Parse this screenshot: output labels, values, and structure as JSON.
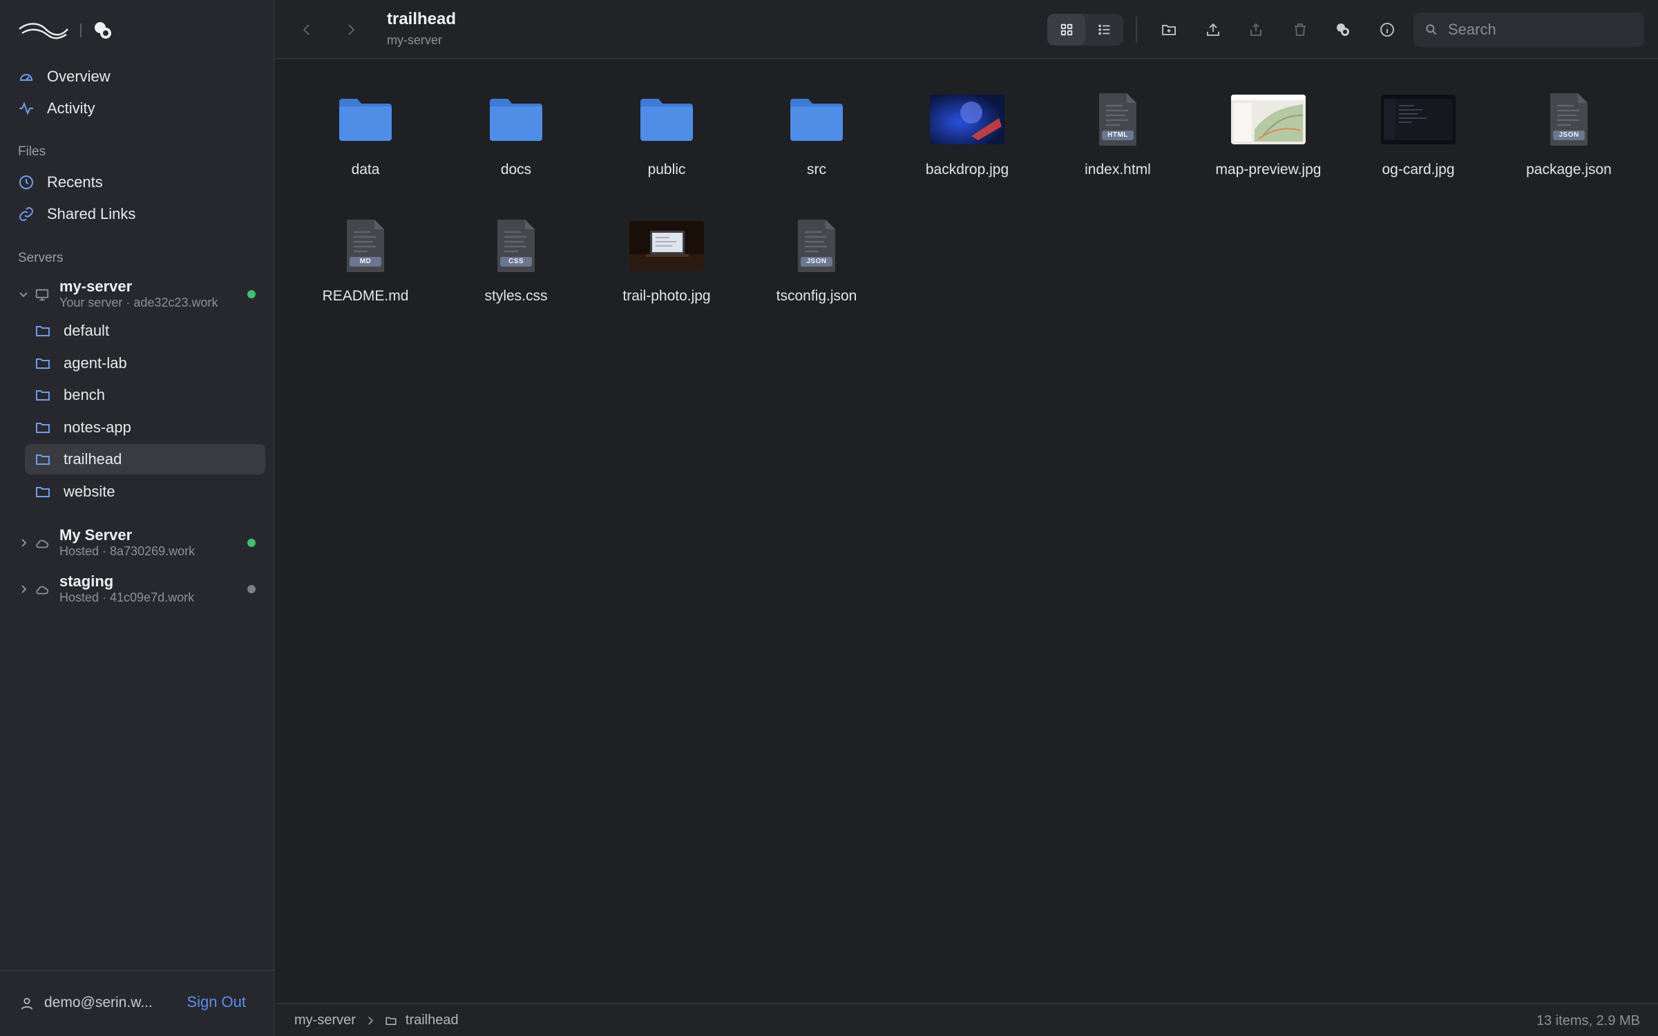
{
  "sidebar": {
    "nav": [
      {
        "label": "Overview",
        "icon": "gauge-icon"
      },
      {
        "label": "Activity",
        "icon": "activity-icon"
      }
    ],
    "files_label": "Files",
    "files": [
      {
        "label": "Recents",
        "icon": "clock-icon"
      },
      {
        "label": "Shared Links",
        "icon": "link-icon"
      }
    ],
    "servers_label": "Servers",
    "servers": [
      {
        "name": "my-server",
        "sub": "Your server · ade32c23.work",
        "status": "online",
        "expanded": true
      },
      {
        "name": "My Server",
        "sub": "Hosted · 8a730269.work",
        "status": "online",
        "expanded": false
      },
      {
        "name": "staging",
        "sub": "Hosted · 41c09e7d.work",
        "status": "offline",
        "expanded": false
      }
    ],
    "folders": [
      "default",
      "agent-lab",
      "bench",
      "notes-app",
      "trailhead",
      "website"
    ],
    "active_folder": "trailhead",
    "user": {
      "email": "demo@serin.w...",
      "sign_out": "Sign Out"
    }
  },
  "header": {
    "title": "trailhead",
    "subtitle": "my-server",
    "search_placeholder": "Search"
  },
  "files": [
    {
      "name": "data",
      "kind": "folder"
    },
    {
      "name": "docs",
      "kind": "folder"
    },
    {
      "name": "public",
      "kind": "folder"
    },
    {
      "name": "src",
      "kind": "folder"
    },
    {
      "name": "backdrop.jpg",
      "kind": "image"
    },
    {
      "name": "index.html",
      "kind": "doc",
      "badge": "HTML"
    },
    {
      "name": "map-preview.jpg",
      "kind": "image"
    },
    {
      "name": "og-card.jpg",
      "kind": "image"
    },
    {
      "name": "package.json",
      "kind": "doc",
      "badge": "JSON"
    },
    {
      "name": "README.md",
      "kind": "doc",
      "badge": "MD"
    },
    {
      "name": "styles.css",
      "kind": "doc",
      "badge": "CSS"
    },
    {
      "name": "trail-photo.jpg",
      "kind": "image"
    },
    {
      "name": "tsconfig.json",
      "kind": "doc",
      "badge": "JSON"
    }
  ],
  "status": {
    "crumb_root": "my-server",
    "crumb_folder": "trailhead",
    "summary": "13 items, 2.9 MB"
  },
  "colors": {
    "accent": "#5b8def",
    "online": "#3fbf6f",
    "offline": "#7d7f86",
    "folder": "#4f8de6"
  }
}
